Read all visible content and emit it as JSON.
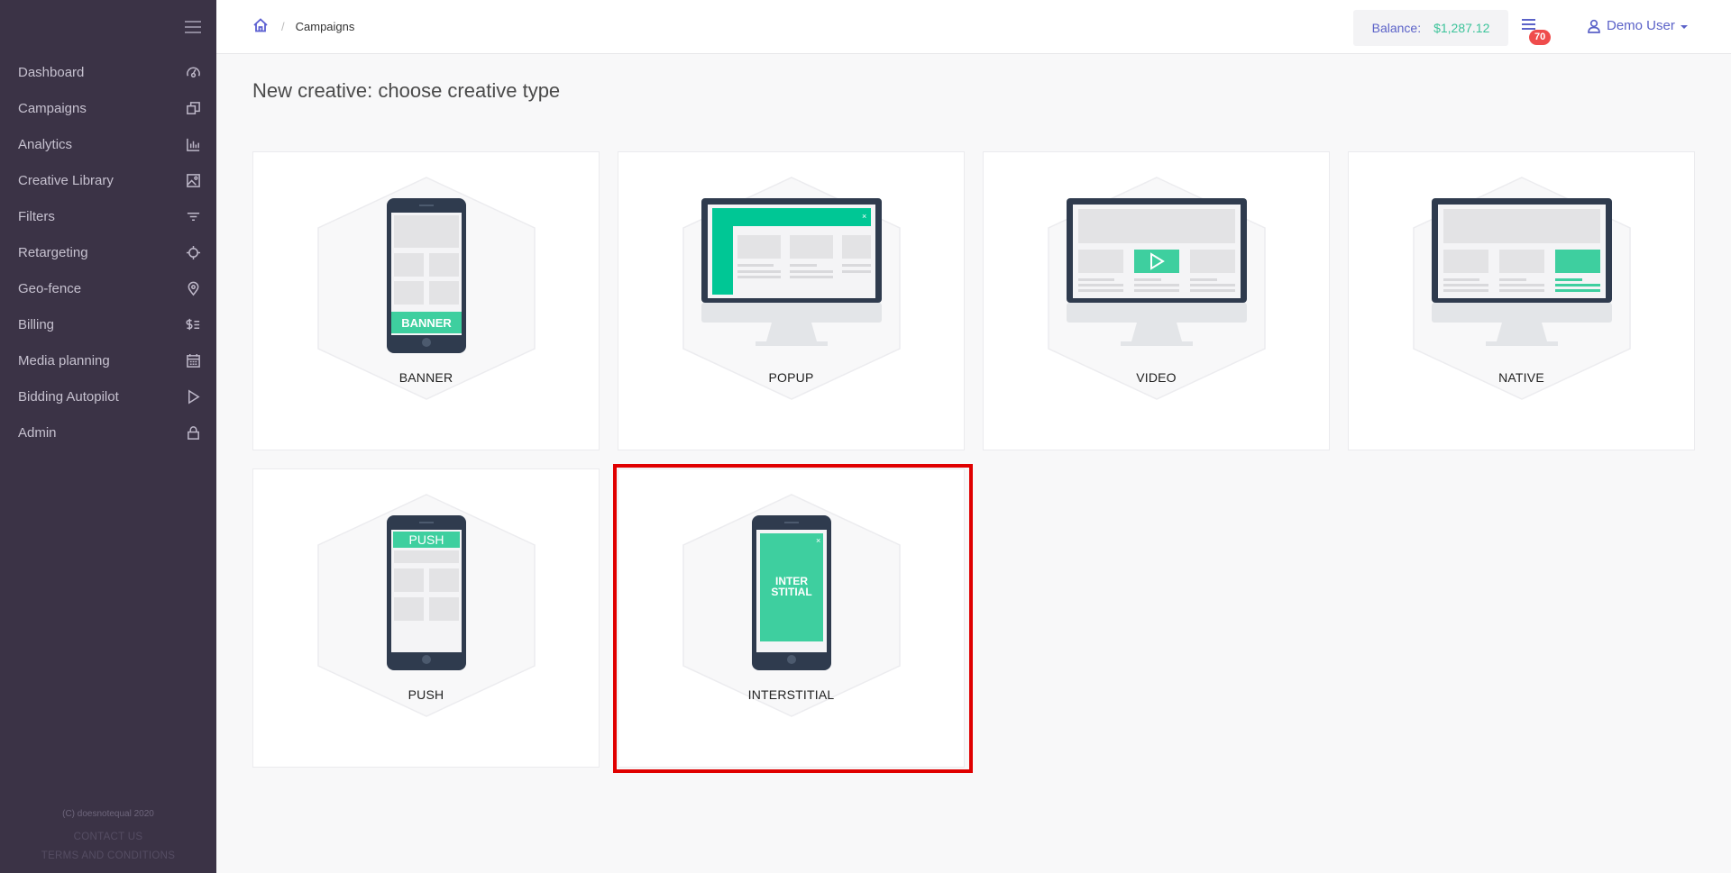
{
  "sidebar": {
    "items": [
      {
        "label": "Dashboard",
        "icon": "dashboard-icon"
      },
      {
        "label": "Campaigns",
        "icon": "campaigns-icon"
      },
      {
        "label": "Analytics",
        "icon": "analytics-icon"
      },
      {
        "label": "Creative Library",
        "icon": "image-icon"
      },
      {
        "label": "Filters",
        "icon": "filter-icon"
      },
      {
        "label": "Retargeting",
        "icon": "crosshair-icon"
      },
      {
        "label": "Geo-fence",
        "icon": "location-pin-icon"
      },
      {
        "label": "Billing",
        "icon": "billing-icon"
      },
      {
        "label": "Media planning",
        "icon": "calendar-icon"
      },
      {
        "label": "Bidding Autopilot",
        "icon": "play-icon"
      },
      {
        "label": "Admin",
        "icon": "lock-icon"
      }
    ],
    "footer": {
      "copyright": "(C) doesnotequal 2020",
      "contact": "CONTACT US",
      "terms": "TERMS AND CONDITIONS"
    }
  },
  "header": {
    "breadcrumb": "Campaigns",
    "balance_label": "Balance:",
    "balance_value": "$1,287.12",
    "notification_count": "70",
    "user_name": "Demo User"
  },
  "main": {
    "title": "New creative: choose creative type",
    "cards": [
      {
        "label": "BANNER",
        "screen_text": "BANNER"
      },
      {
        "label": "POPUP"
      },
      {
        "label": "VIDEO"
      },
      {
        "label": "NATIVE"
      },
      {
        "label": "PUSH",
        "screen_text": "PUSH"
      },
      {
        "label": "INTERSTITIAL",
        "screen_text_1": "INTER",
        "screen_text_2": "STITIAL"
      }
    ]
  },
  "colors": {
    "sidebar_bg": "#3b3346",
    "accent": "#5b62c8",
    "green": "#3ecf9f",
    "badge_red": "#ef4c4c",
    "highlight_border": "#e00000"
  }
}
